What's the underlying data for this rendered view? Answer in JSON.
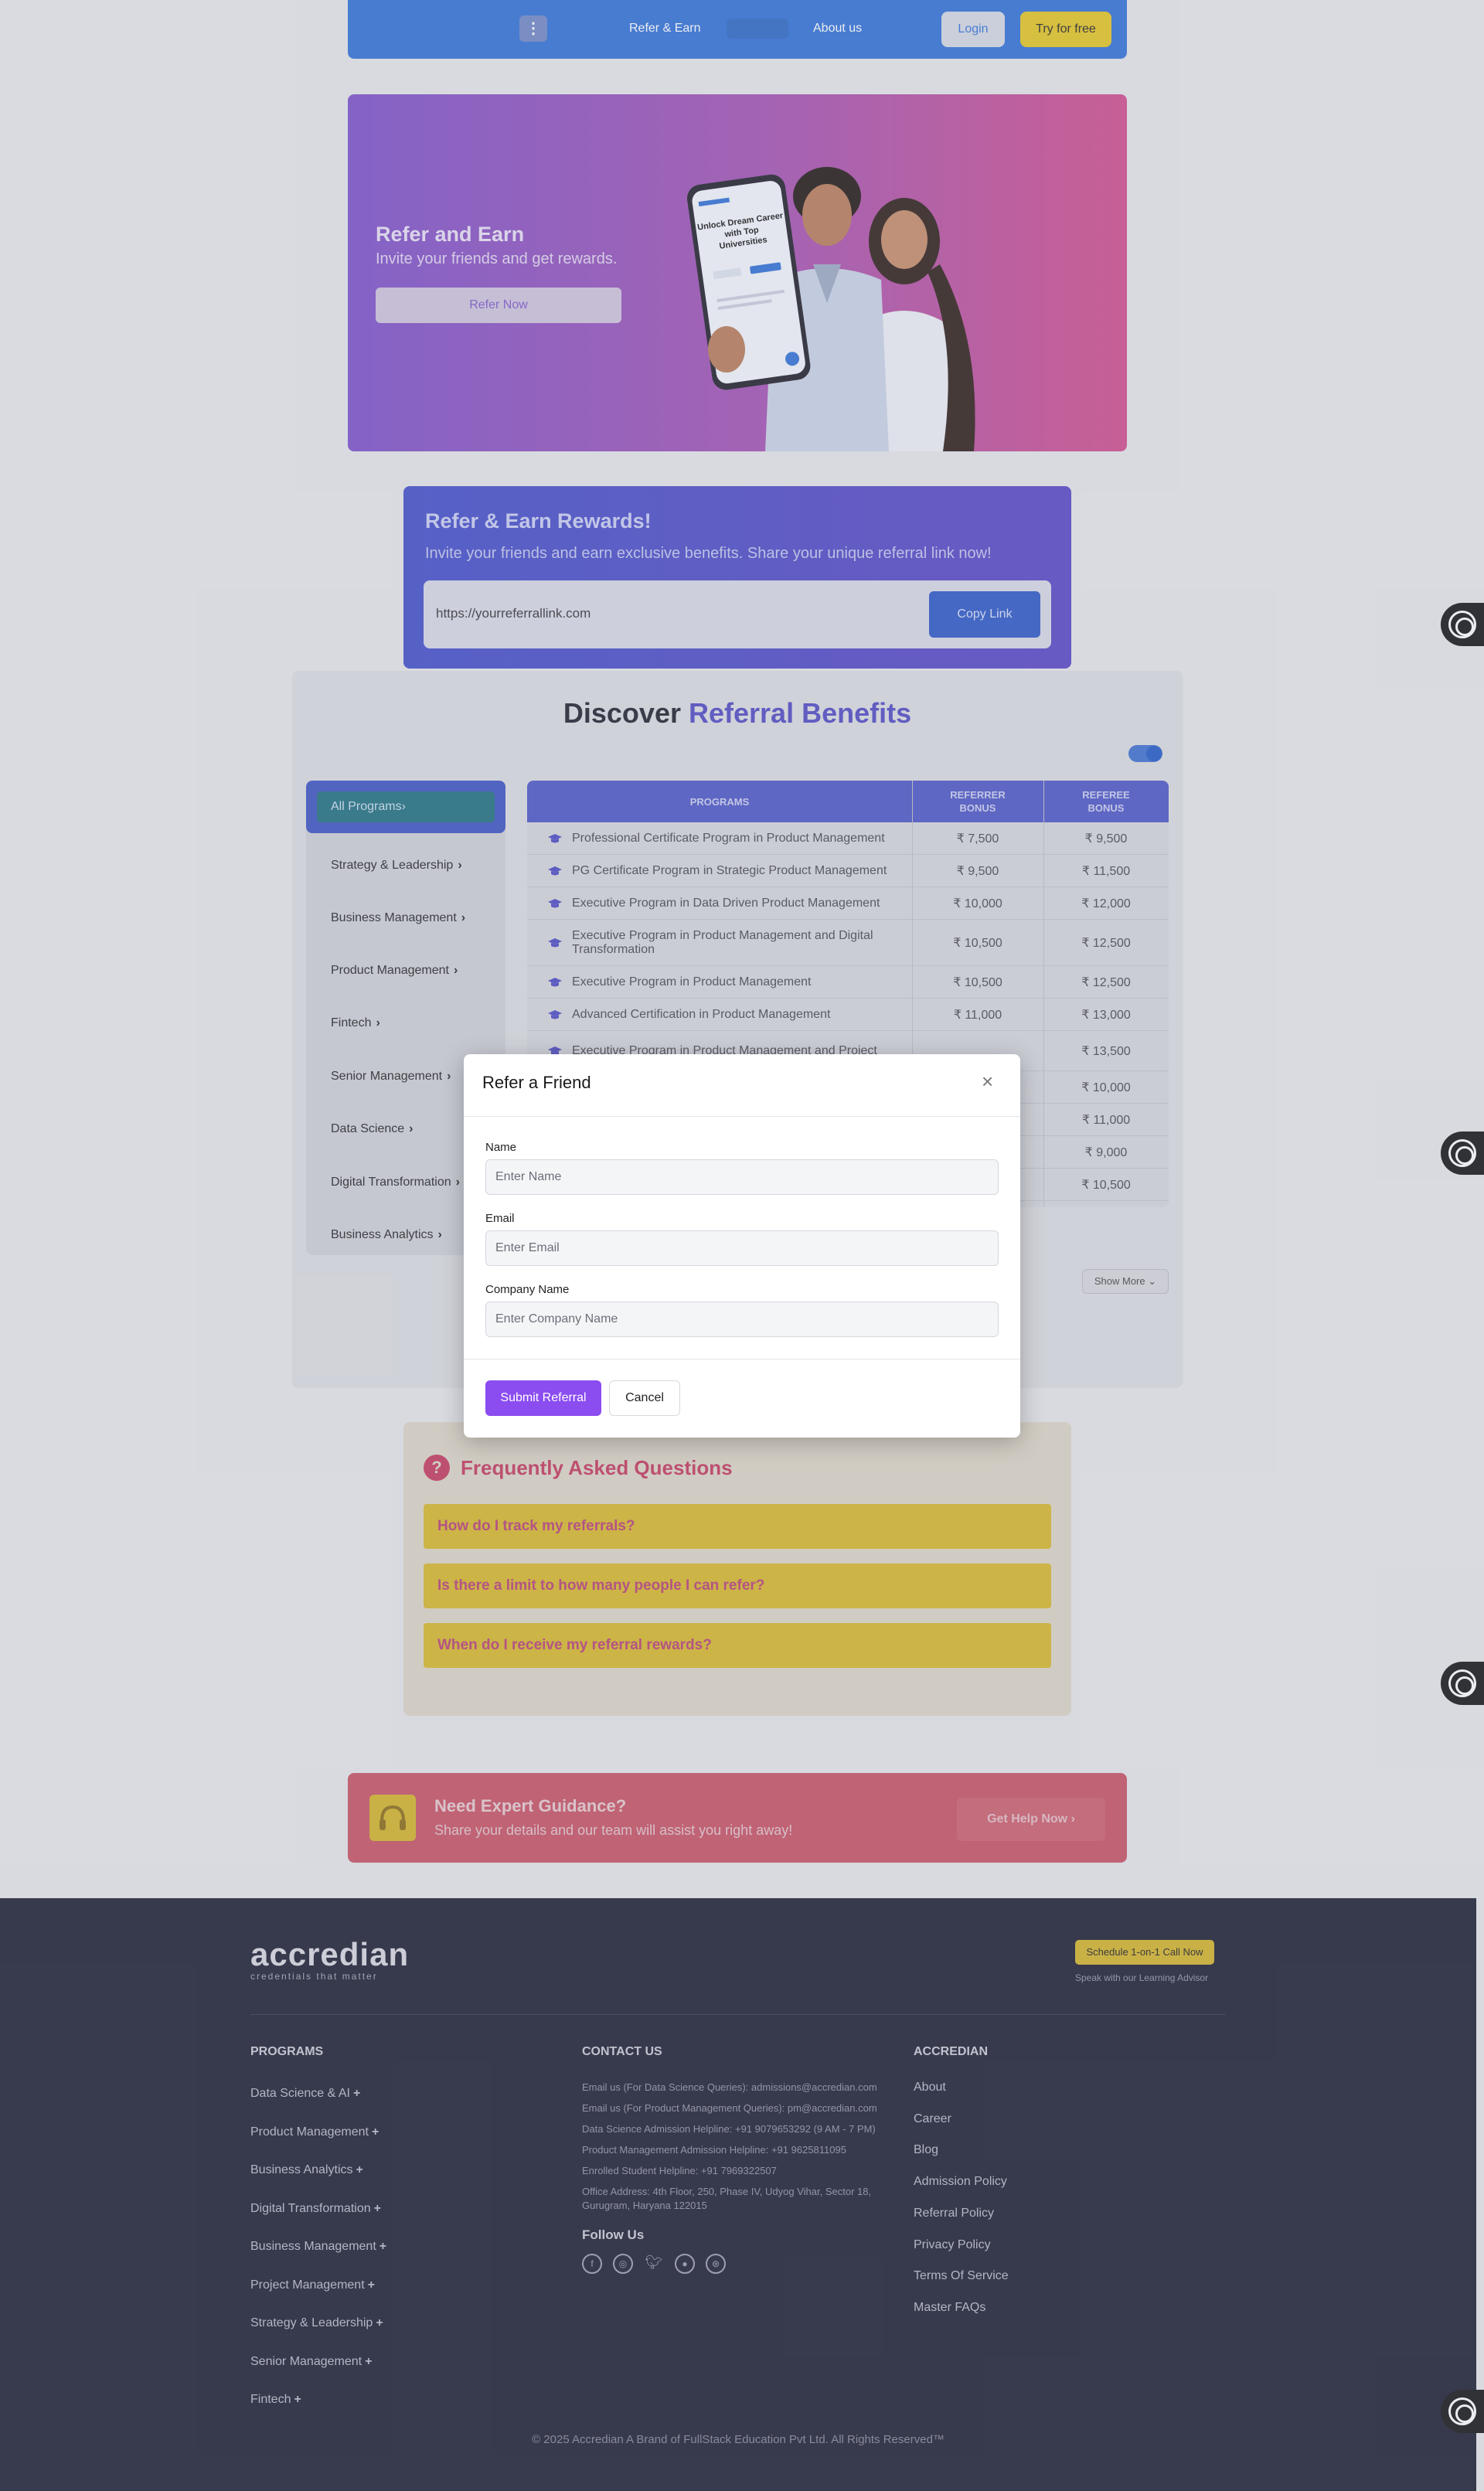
{
  "nav": {
    "logo_caption": "",
    "links": [
      "Refer & Earn",
      "About us"
    ],
    "login": "Login",
    "try_free": "Try for free"
  },
  "hero": {
    "title": "Refer and Earn",
    "subtitle": "Invite your friends and get rewards.",
    "button": "Refer Now",
    "phone_text": "Unlock Dream Career with Top Universities"
  },
  "rewards": {
    "title": "Refer & Earn Rewards!",
    "subtitle": "Invite your friends and earn exclusive benefits. Share your unique referral link now!",
    "link": "https://yourreferrallink.com",
    "copy": "Copy Link"
  },
  "discover": {
    "title_plain": "Discover",
    "title_accent": "Referral Benefits",
    "categories": [
      "All Programs",
      "Strategy & Leadership",
      "Business Management",
      "Product Management",
      "Fintech",
      "Senior Management",
      "Data Science",
      "Digital Transformation",
      "Business Analytics"
    ],
    "columns": [
      "PROGRAMS",
      "REFERRER BONUS",
      "REFEREE BONUS"
    ],
    "rows": [
      {
        "program": "Professional Certificate Program in Product Management",
        "referrer": "₹ 7,500",
        "referee": "₹ 9,500"
      },
      {
        "program": "PG Certificate Program in Strategic Product Management",
        "referrer": "₹ 9,500",
        "referee": "₹ 11,500"
      },
      {
        "program": "Executive Program in Data Driven Product Management",
        "referrer": "₹ 10,000",
        "referee": "₹ 12,000"
      },
      {
        "program": "Executive Program in Product Management and Digital Transformation",
        "referrer": "₹ 10,500",
        "referee": "₹ 12,500"
      },
      {
        "program": "Executive Program in Product Management",
        "referrer": "₹ 10,500",
        "referee": "₹ 12,500"
      },
      {
        "program": "Advanced Certification in Product Management",
        "referrer": "₹ 11,000",
        "referee": "₹ 13,000"
      },
      {
        "program": "Executive Program in Product Management and Project",
        "referrer": "",
        "referee": "₹ 13,500"
      },
      {
        "program": "",
        "referrer": "",
        "referee": "₹ 10,000"
      },
      {
        "program": "",
        "referrer": "",
        "referee": "₹ 11,000"
      },
      {
        "program": "",
        "referrer": "",
        "referee": "₹ 9,000"
      },
      {
        "program": "",
        "referrer": "",
        "referee": "₹ 10,500"
      }
    ],
    "show_more": "Show More"
  },
  "faq": {
    "title": "Frequently Asked Questions",
    "questions": [
      "How do I track my referrals?",
      "Is there a limit to how many people I can refer?",
      "When do I receive my referral rewards?"
    ]
  },
  "expert": {
    "title": "Need Expert Guidance?",
    "subtitle": "Share your details and our team will assist you right away!",
    "button": "Get Help Now ›"
  },
  "footer": {
    "brand": "accredian",
    "tagline": "credentials that matter",
    "schedule": "Schedule 1-on-1 Call Now",
    "speak": "Speak with our Learning Advisor",
    "programs_heading": "PROGRAMS",
    "programs": [
      "Data Science & AI",
      "Product Management",
      "Business Analytics",
      "Digital Transformation",
      "Business Management",
      "Project Management",
      "Strategy & Leadership",
      "Senior Management",
      "Fintech"
    ],
    "contact_heading": "CONTACT US",
    "contact": [
      "Email us (For Data Science Queries): admissions@accredian.com",
      "Email us (For Product Management Queries): pm@accredian.com",
      "Data Science Admission Helpline: +91 9079653292 (9 AM - 7 PM)",
      "Product Management Admission Helpline: +91 9625811095",
      "Enrolled Student Helpline: +91 7969322507",
      "Office Address: 4th Floor, 250, Phase IV, Udyog Vihar, Sector 18, Gurugram, Haryana 122015"
    ],
    "follow": "Follow Us",
    "social_icons": [
      "facebook-icon",
      "instagram-icon",
      "twitter-icon",
      "github-icon",
      "dribbble-icon"
    ],
    "accredian_heading": "ACCREDIAN",
    "accredian_links": [
      "About",
      "Career",
      "Blog",
      "Admission Policy",
      "Referral Policy",
      "Privacy Policy",
      "Terms Of Service",
      "Master FAQs"
    ],
    "copyright": "© 2025 Accredian A Brand of FullStack Education Pvt Ltd. All Rights Reserved™"
  },
  "modal": {
    "title": "Refer a Friend",
    "name_label": "Name",
    "name_placeholder": "Enter Name",
    "email_label": "Email",
    "email_placeholder": "Enter Email",
    "company_label": "Company Name",
    "company_placeholder": "Enter Company Name",
    "submit": "Submit Referral",
    "cancel": "Cancel"
  }
}
